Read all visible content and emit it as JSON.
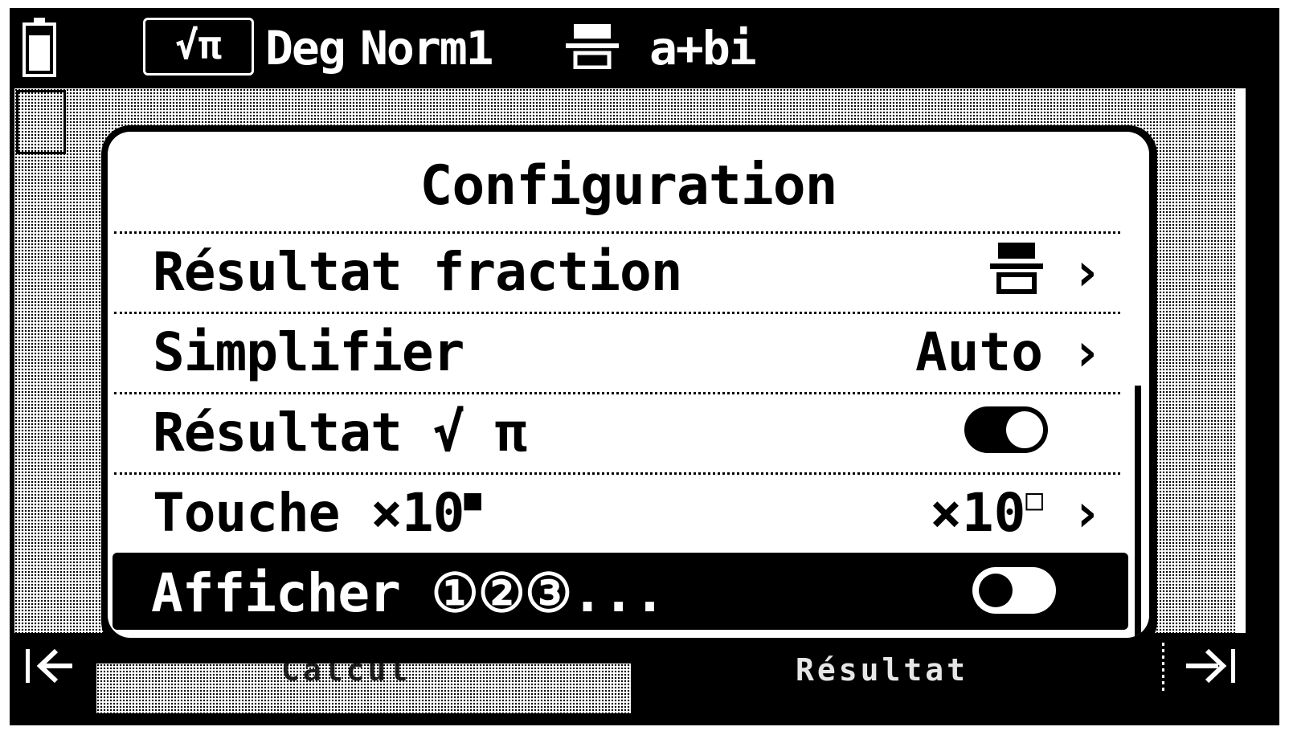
{
  "statusbar": {
    "battery_icon": "battery-icon",
    "math_mode": "√π",
    "angle_unit": "Deg",
    "display_format": "Norm1",
    "fraction_icon": "fraction-icon",
    "complex_mode": "a+bi"
  },
  "dialog": {
    "title": "Configuration",
    "rows": [
      {
        "label": "Résultat fraction",
        "value_icon": "fraction-icon",
        "control": "chevron"
      },
      {
        "label": "Simplifier",
        "value": "Auto",
        "control": "chevron"
      },
      {
        "label": "Résultat √ π",
        "control": "toggle",
        "state": "on"
      },
      {
        "label": "Touche ×10",
        "label_sup": "■",
        "value": "×10",
        "value_sup": "□",
        "control": "chevron"
      },
      {
        "label": "Afficher ①②③...",
        "control": "toggle",
        "state": "off",
        "selected": true
      }
    ]
  },
  "bottombar": {
    "left_icon": "nav-left-icon",
    "left_label": "Calcul",
    "right_label": "Résultat",
    "right_icon": "nav-right-icon"
  },
  "chevron": "›"
}
